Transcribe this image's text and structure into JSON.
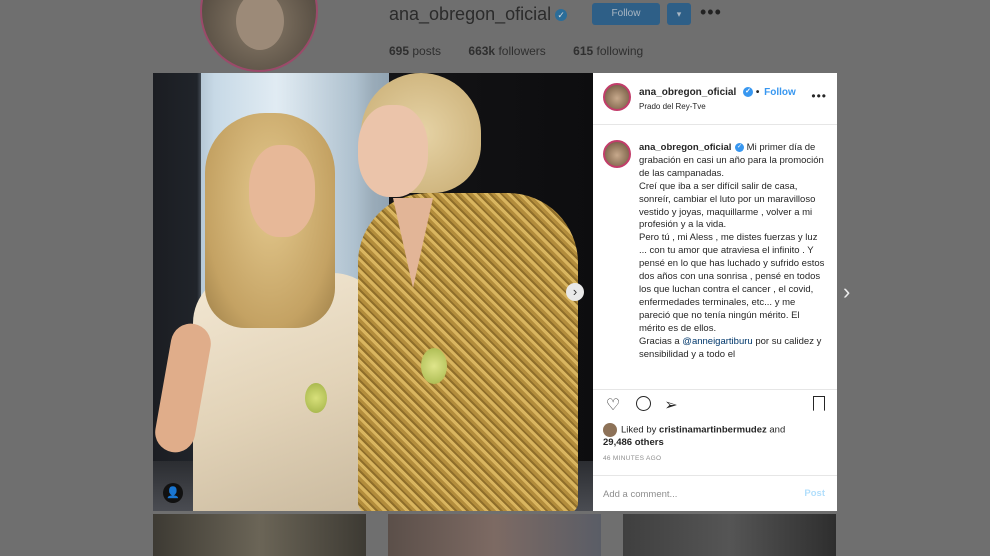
{
  "profile": {
    "username": "ana_obregon_oficial",
    "follow_label": "Follow",
    "chevron_label": "▾",
    "more_label": "•••",
    "stats": {
      "posts": "695",
      "posts_label": "posts",
      "followers": "663k",
      "followers_label": "followers",
      "following": "615",
      "following_label": "following"
    }
  },
  "post": {
    "header": {
      "username": "ana_obregon_oficial",
      "separator": "•",
      "follow_label": "Follow",
      "location": "Prado del Rey-Tve",
      "more_label": "•••"
    },
    "caption": {
      "username": "ana_obregon_oficial",
      "text_1": "Mi primer día de grabación en casi un año para la promoción de las campanadas.",
      "text_2": "Creí que iba a ser difícil salir de casa, sonreír, cambiar el luto por un maravilloso vestido y joyas, maquillarme , volver a mi profesión y a la vida.",
      "text_3": "Pero tú , mi Aless , me distes fuerzas y luz ... con tu amor que atraviesa el infinito . Y pensé en lo que has luchado y sufrido estos dos años con una sonrisa , pensé en todos los que luchan contra el cancer , el covid, enfermedades terminales, etc... y me pareció que no tenía ningún mérito. El mérito es de ellos.",
      "text_4_prefix": "Gracias a",
      "mention": "@anneigartiburu",
      "text_4_suffix": "por su calidez y sensibilidad y a todo el"
    },
    "likes": {
      "prefix": "Liked by",
      "user": "cristinamartinbermudez",
      "and": "and",
      "others": "29,486 others"
    },
    "timestamp": "46 MINUTES AGO",
    "comment_placeholder": "Add a comment...",
    "post_label": "Post"
  },
  "icons": {
    "verified": "✓",
    "user_tag": "👤",
    "photo_next": "›",
    "modal_next": "›",
    "heart": "♡",
    "share": "➢"
  },
  "colors": {
    "accent": "#3897f0",
    "avatar_ring": "#c23d6a",
    "overlay": "#6f6f6f"
  }
}
